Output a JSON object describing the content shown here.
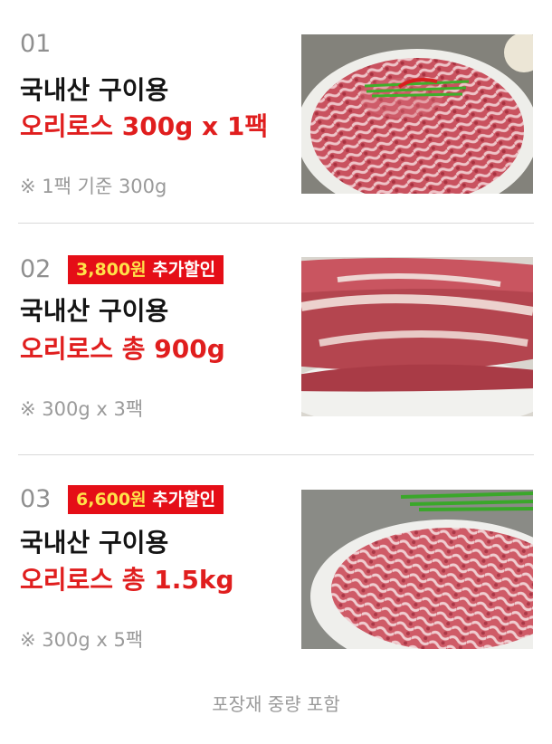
{
  "options": [
    {
      "number": "01",
      "line1": "국내산 구이용",
      "line2": "오리로스 300g x 1팩",
      "note": "※ 1팩 기준 300g"
    },
    {
      "number": "02",
      "badge_amount": "3,800원",
      "badge_text": " 추가할인",
      "line1": "국내산 구이용",
      "line2": "오리로스 총 900g",
      "note": "※ 300g x 3팩"
    },
    {
      "number": "03",
      "badge_amount": "6,600원",
      "badge_text": " 추가할인",
      "line1": "국내산 구이용",
      "line2": "오리로스 총 1.5kg",
      "note": "※ 300g x 5팩"
    }
  ],
  "footer": "포장재 중량 포함",
  "colors": {
    "accent_red": "#e01e1e",
    "badge_red": "#e50e17",
    "badge_amount_yellow": "#ffe24a",
    "gray_text": "#9a9a9a"
  },
  "icons": [
    "duck-meat-plate-photo-1",
    "duck-meat-plate-photo-2",
    "duck-meat-plate-photo-3"
  ]
}
